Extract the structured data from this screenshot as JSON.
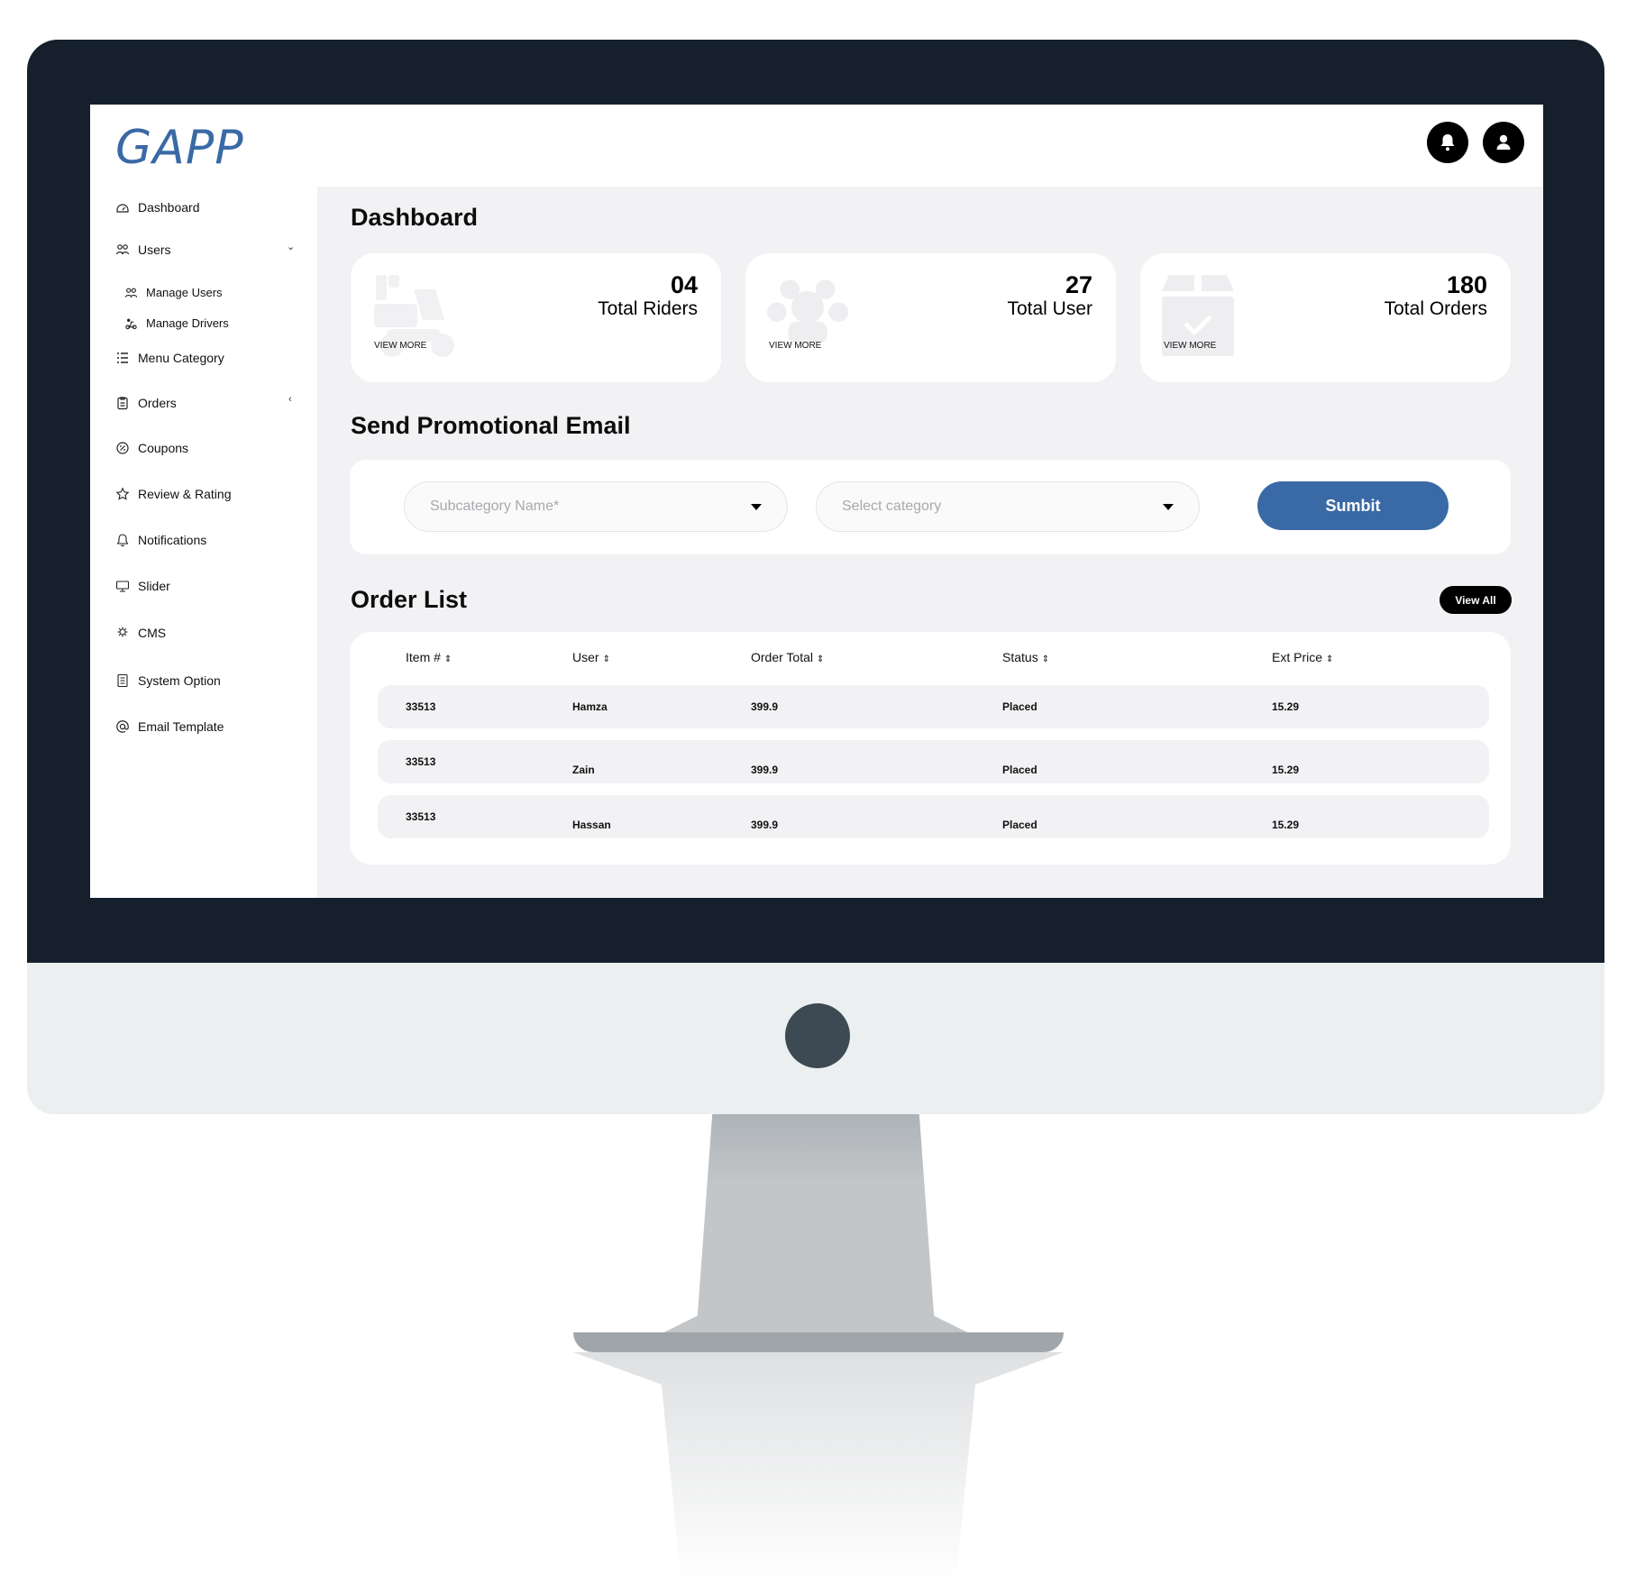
{
  "app": {
    "logo_text": "GAPP",
    "brand_color": "#3a6aa6"
  },
  "header": {
    "icons": [
      "bell-icon",
      "user-icon"
    ]
  },
  "sidebar": {
    "items": [
      {
        "label": "Dashboard",
        "icon": "dashboard-icon"
      },
      {
        "label": "Users",
        "icon": "users-icon",
        "expanded": true
      },
      {
        "label": "Manage Users",
        "icon": "users-icon"
      },
      {
        "label": "Manage Drivers",
        "icon": "driver-icon"
      },
      {
        "label": "Menu Category",
        "icon": "list-icon"
      },
      {
        "label": "Orders",
        "icon": "clipboard-icon"
      },
      {
        "label": "Coupons",
        "icon": "coupon-icon"
      },
      {
        "label": "Review & Rating",
        "icon": "star-icon"
      },
      {
        "label": "Notifications",
        "icon": "bell-icon"
      },
      {
        "label": "Slider",
        "icon": "slider-icon"
      },
      {
        "label": "CMS",
        "icon": "cms-icon"
      },
      {
        "label": "System Option",
        "icon": "document-icon"
      },
      {
        "label": "Email Template",
        "icon": "at-icon"
      }
    ]
  },
  "main": {
    "title": "Dashboard",
    "cards": [
      {
        "value": "04",
        "label": "Total Riders",
        "link": "VIEW MORE",
        "icon": "scooter-icon"
      },
      {
        "value": "27",
        "label": "Total User",
        "link": "VIEW MORE",
        "icon": "group-icon"
      },
      {
        "value": "180",
        "label": "Total Orders",
        "link": "VIEW MORE",
        "icon": "box-icon"
      }
    ],
    "promo": {
      "title": "Send Promotional Email",
      "subcategory_placeholder": "Subcategory Name*",
      "category_placeholder": "Select category",
      "submit_label": "Sumbit"
    },
    "orders": {
      "title": "Order List",
      "view_all_label": "View All",
      "columns": [
        "Item #",
        "User",
        "Order Total",
        "Status",
        "Ext Price"
      ],
      "rows": [
        [
          "33513",
          "Hamza",
          "399.9",
          "Placed",
          "15.29"
        ],
        [
          "33513",
          "Zain",
          "399.9",
          "Placed",
          "15.29"
        ],
        [
          "33513",
          "Hassan",
          "399.9",
          "Placed",
          "15.29"
        ]
      ]
    }
  }
}
